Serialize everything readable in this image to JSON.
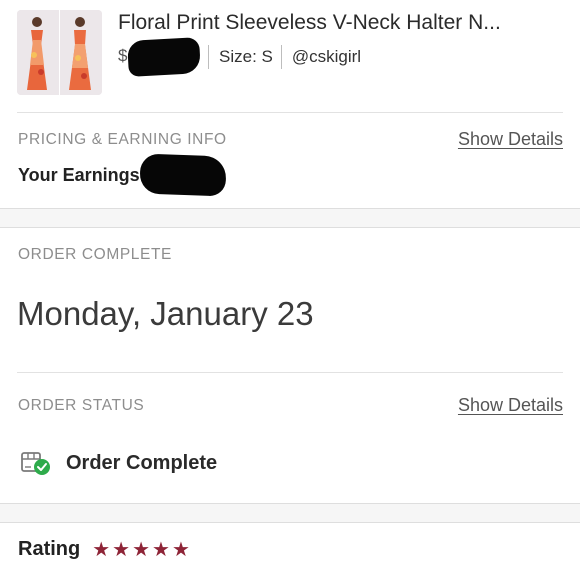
{
  "product": {
    "title": "Floral Print Sleeveless V-Neck Halter N...",
    "price_prefix": "$",
    "size_text": "Size: S",
    "username": "@cskigirl",
    "thumbnail": "dress-thumbnail"
  },
  "pricing": {
    "section_label": "PRICING & EARNING INFO",
    "details_link": "Show Details",
    "earnings_label": "Your Earnings:"
  },
  "order_complete": {
    "section_label": "ORDER COMPLETE",
    "date": "Monday, January 23"
  },
  "order_status": {
    "section_label": "ORDER STATUS",
    "details_link": "Show Details",
    "status_text": "Order Complete",
    "status_icon": "box-check-icon"
  },
  "rating": {
    "label": "Rating",
    "stars": 5
  },
  "colors": {
    "accent_star": "#8e2437",
    "check_green": "#2eab4b",
    "label_gray": "#8d8d8d"
  }
}
